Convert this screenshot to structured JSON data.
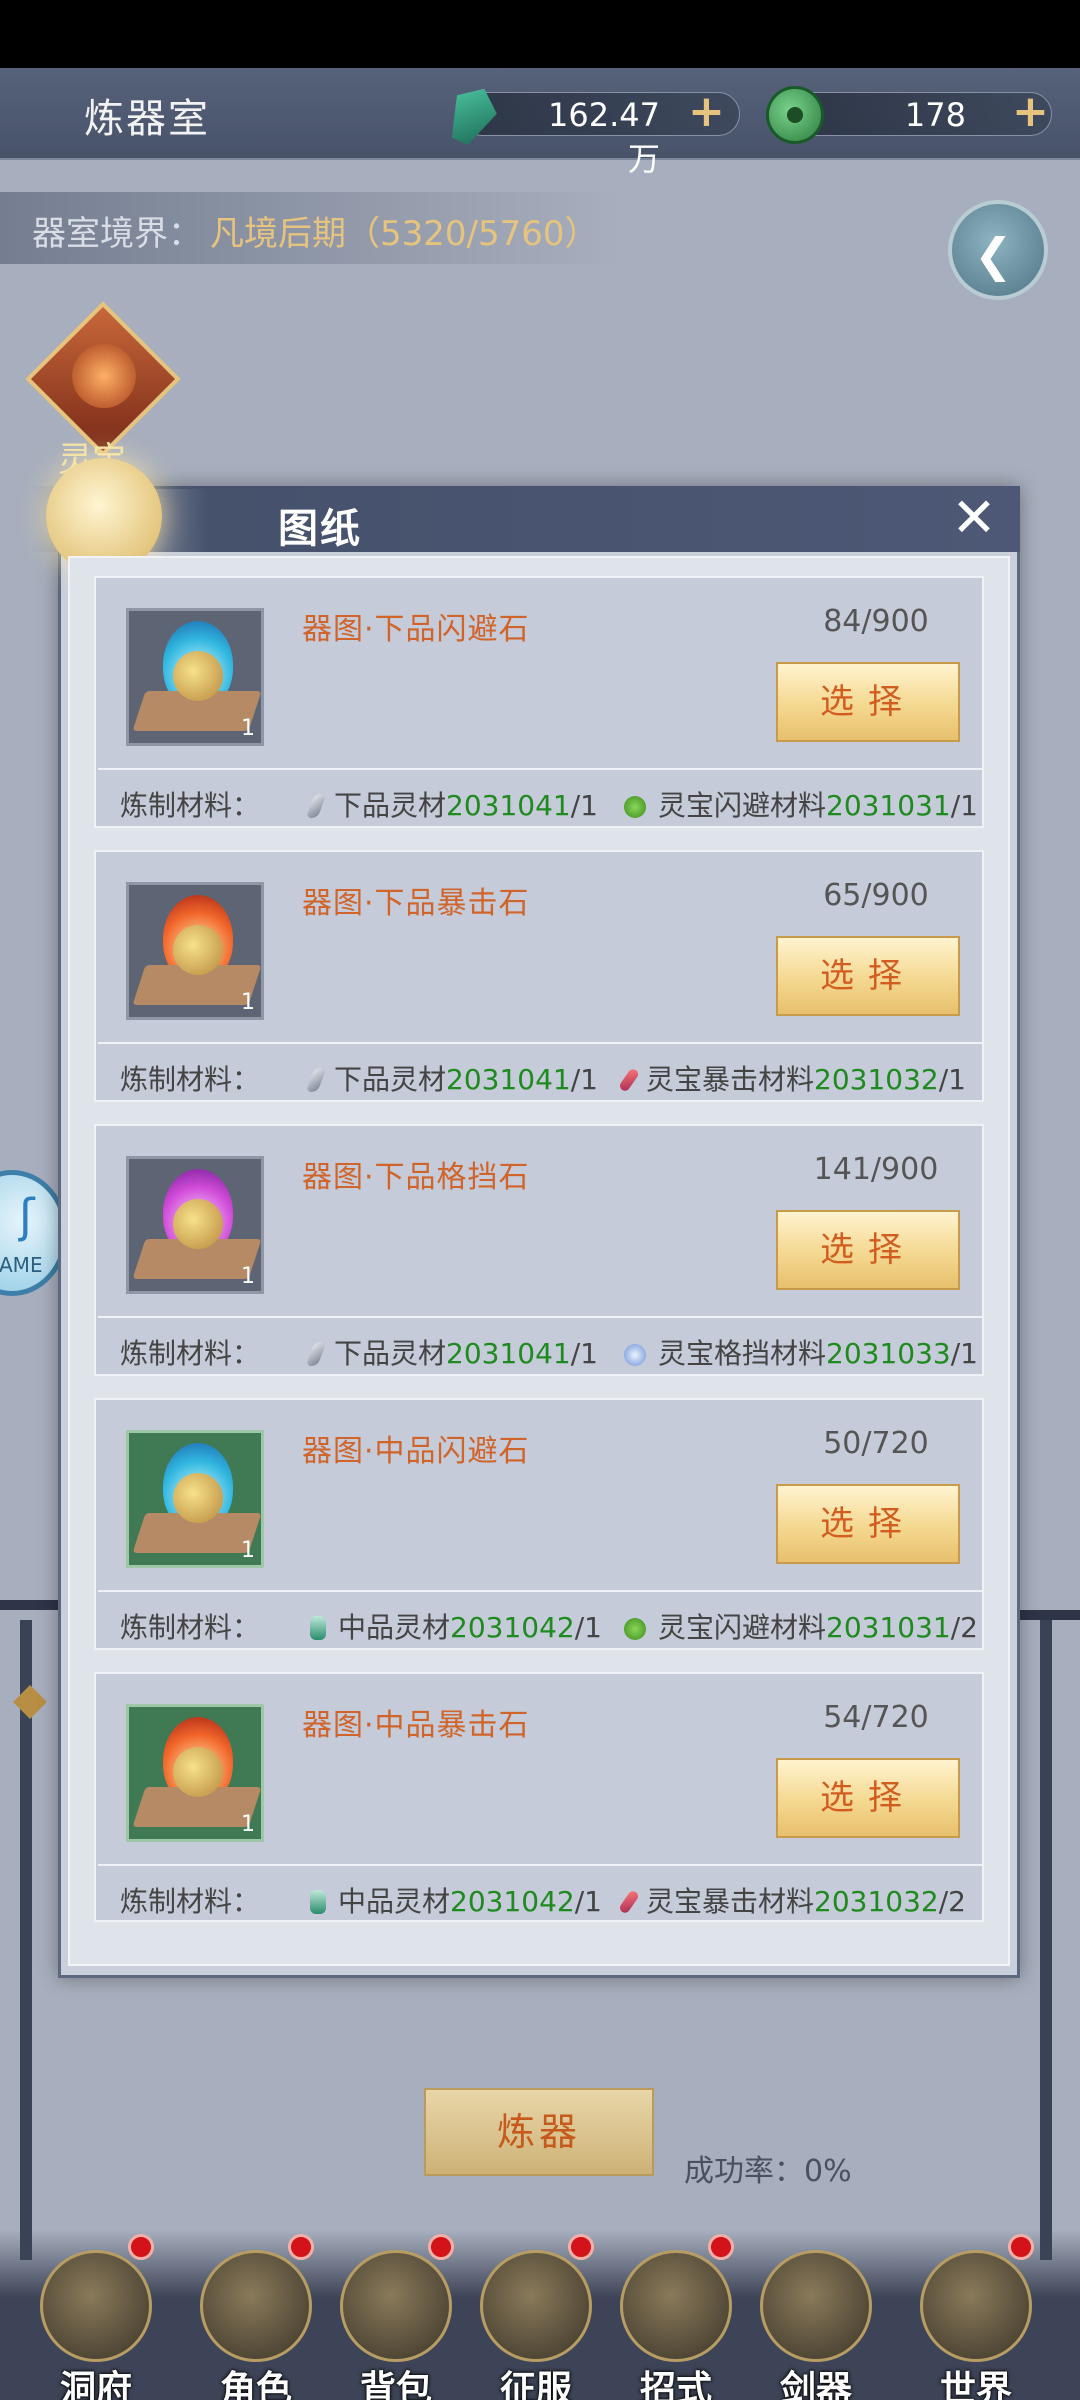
{
  "topbar": {
    "title": "炼器室",
    "spirit_stone": "162.47万",
    "jade": "178",
    "plus": "+"
  },
  "realm": {
    "label": "器室境界：",
    "value": "凡境后期（5320/5760）"
  },
  "treasure_label": "灵宝",
  "side_game_text": "AME",
  "modal": {
    "title": "图纸",
    "close": "✕"
  },
  "mat_label": "炼制材料：",
  "select_label": "选择",
  "cards": [
    {
      "name": "器图·下品闪避石",
      "count": "84/900",
      "qty": "1",
      "frame": "gray",
      "flame": "cyan",
      "mat1_name": "下品灵材",
      "mat1_code": "2031041",
      "mat1_qty": "/1",
      "mat1_icon": "crystal-icon",
      "mat2_name": "灵宝闪避材料",
      "mat2_code": "2031031",
      "mat2_qty": "/1",
      "mat2_icon": "leaf-icon"
    },
    {
      "name": "器图·下品暴击石",
      "count": "65/900",
      "qty": "1",
      "frame": "gray",
      "flame": "red",
      "mat1_name": "下品灵材",
      "mat1_code": "2031041",
      "mat1_qty": "/1",
      "mat1_icon": "crystal-icon",
      "mat2_name": "灵宝暴击材料",
      "mat2_code": "2031032",
      "mat2_qty": "/1",
      "mat2_icon": "red-feather-icon"
    },
    {
      "name": "器图·下品格挡石",
      "count": "141/900",
      "qty": "1",
      "frame": "gray",
      "flame": "purple",
      "mat1_name": "下品灵材",
      "mat1_code": "2031041",
      "mat1_qty": "/1",
      "mat1_icon": "crystal-icon",
      "mat2_name": "灵宝格挡材料",
      "mat2_code": "2031033",
      "mat2_qty": "/1",
      "mat2_icon": "blue-crystal-icon"
    },
    {
      "name": "器图·中品闪避石",
      "count": "50/720",
      "qty": "1",
      "frame": "green",
      "flame": "cyan",
      "mat1_name": "中品灵材",
      "mat1_code": "2031042",
      "mat1_qty": "/1",
      "mat1_icon": "jade-icon",
      "mat2_name": "灵宝闪避材料",
      "mat2_code": "2031031",
      "mat2_qty": "/2",
      "mat2_icon": "leaf-icon"
    },
    {
      "name": "器图·中品暴击石",
      "count": "54/720",
      "qty": "1",
      "frame": "green",
      "flame": "red",
      "mat1_name": "中品灵材",
      "mat1_code": "2031042",
      "mat1_qty": "/1",
      "mat1_icon": "jade-icon",
      "mat2_name": "灵宝暴击材料",
      "mat2_code": "2031032",
      "mat2_qty": "/2",
      "mat2_icon": "red-feather-icon"
    }
  ],
  "refine": {
    "button": "炼器",
    "success_rate": "成功率：0%"
  },
  "nav": [
    {
      "label": "洞府",
      "badge": true
    },
    {
      "label": "角色",
      "badge": true
    },
    {
      "label": "背包",
      "badge": true
    },
    {
      "label": "征服",
      "badge": true
    },
    {
      "label": "招式",
      "badge": true
    },
    {
      "label": "剑器",
      "badge": false
    },
    {
      "label": "世界",
      "badge": true
    }
  ],
  "colors": {
    "accent_orange": "#d0642a",
    "code_green": "#1f8a1f",
    "badge_red": "#d3121a"
  }
}
